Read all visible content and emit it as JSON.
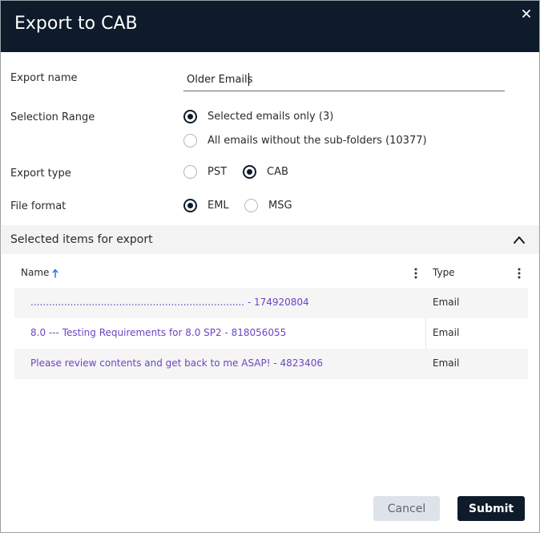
{
  "dialog": {
    "title": "Export to CAB",
    "close_icon": "close-icon"
  },
  "form": {
    "export_name_label": "Export name",
    "export_name_value": "Older Emails",
    "selection_range_label": "Selection Range",
    "selection_options": [
      {
        "label": "Selected emails only (3)",
        "checked": true
      },
      {
        "label": "All emails without the sub-folders (10377)",
        "checked": false
      }
    ],
    "export_type_label": "Export type",
    "export_type_options": [
      {
        "label": "PST",
        "checked": false
      },
      {
        "label": "CAB",
        "checked": true
      }
    ],
    "file_format_label": "File format",
    "file_format_options": [
      {
        "label": "EML",
        "checked": true
      },
      {
        "label": "MSG",
        "checked": false
      }
    ]
  },
  "section": {
    "title": "Selected items for export",
    "collapse_icon": "chevron-up-icon"
  },
  "grid": {
    "columns": [
      {
        "label": "Name",
        "sort_icon": "arrow-up-icon"
      },
      {
        "label": "Type"
      }
    ],
    "rows": [
      {
        "name": "...................................................................... - 174920804",
        "type": "Email"
      },
      {
        "name": "8.0 --- Testing Requirements for 8.0 SP2 - 818056055",
        "type": "Email"
      },
      {
        "name": "Please review contents and get back to me ASAP! - 4823406",
        "type": "Email"
      }
    ]
  },
  "actions": {
    "cancel_label": "Cancel",
    "submit_label": "Submit"
  },
  "colors": {
    "header_bg": "#0d1b2a",
    "link": "#6b46c1",
    "cancel_bg": "#dde3e8",
    "section_bg": "#f3f3f3"
  }
}
